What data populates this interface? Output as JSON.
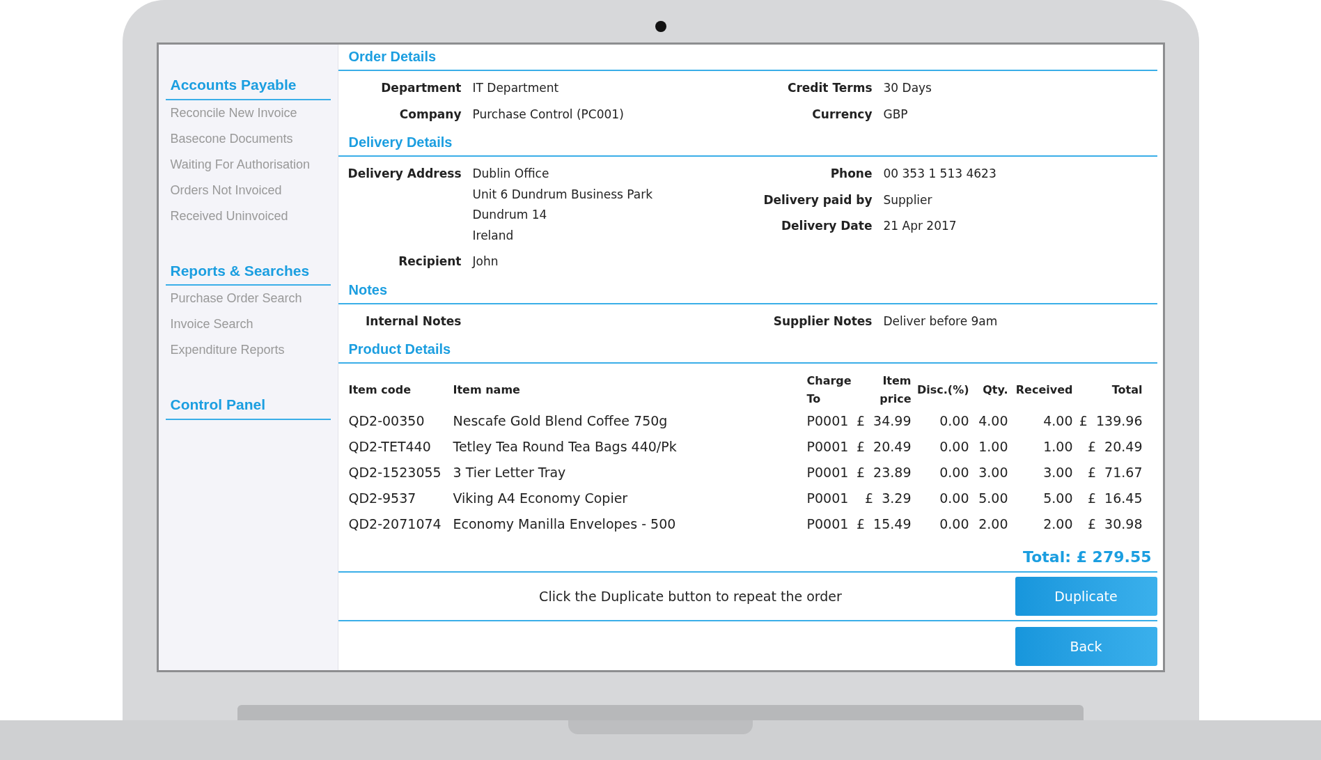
{
  "sidebar": {
    "sections": [
      {
        "title": "Accounts Payable",
        "items": [
          "Reconcile New Invoice",
          "Basecone Documents",
          "Waiting For Authorisation",
          "Orders Not Invoiced",
          "Received Uninvoiced"
        ]
      },
      {
        "title": "Reports & Searches",
        "items": [
          "Purchase Order Search",
          "Invoice Search",
          "Expenditure Reports"
        ]
      },
      {
        "title": "Control Panel"
      }
    ]
  },
  "sections": [
    {
      "title": "Order Details",
      "left": [
        {
          "label": "Department",
          "values": [
            "IT Department"
          ]
        },
        {
          "label": "Company",
          "values": [
            "Purchase Control (PC001)"
          ]
        }
      ],
      "right": [
        {
          "label": "Credit Terms",
          "values": [
            "30 Days"
          ]
        },
        {
          "label": "Currency",
          "values": [
            "GBP"
          ]
        }
      ]
    },
    {
      "title": "Delivery Details",
      "left": [
        {
          "label": "Delivery Address",
          "values": [
            "Dublin Office",
            "Unit 6 Dundrum Business Park",
            "Dundrum 14",
            "Ireland"
          ]
        },
        {
          "label": "Recipient",
          "values": [
            "John"
          ]
        }
      ],
      "right": [
        {
          "label": "Phone",
          "values": [
            "00 353 1 513 4623"
          ]
        },
        {
          "label": "Delivery paid by",
          "values": [
            "Supplier"
          ]
        },
        {
          "label": "Delivery Date",
          "values": [
            "21 Apr 2017"
          ]
        }
      ]
    },
    {
      "title": "Notes",
      "left": [
        {
          "label": "Internal Notes"
        }
      ],
      "right": [
        {
          "label": "Supplier Notes",
          "values": [
            "Deliver before 9am"
          ]
        }
      ]
    }
  ],
  "products": {
    "title": "Product Details",
    "columns": [
      "Item code",
      "Item name",
      "Charge To",
      "Item price",
      "Disc.(%)",
      "Qty.",
      "Received",
      "Total"
    ],
    "rows": [
      [
        "QD2-00350",
        "Nescafe Gold Blend Coffee 750g",
        "P0001",
        "£  34.99",
        "0.00",
        "4.00",
        "4.00",
        "£  139.96"
      ],
      [
        "QD2-TET440",
        "Tetley Tea Round Tea Bags 440/Pk",
        "P0001",
        "£  20.49",
        "0.00",
        "1.00",
        "1.00",
        "£  20.49"
      ],
      [
        "QD2-1523055",
        "3 Tier Letter Tray",
        "P0001",
        "£  23.89",
        "0.00",
        "3.00",
        "3.00",
        "£  71.67"
      ],
      [
        "QD2-9537",
        "Viking A4 Economy Copier",
        "P0001",
        "£  3.29",
        "0.00",
        "5.00",
        "5.00",
        "£  16.45"
      ],
      [
        "QD2-2071074",
        "Economy Manilla Envelopes - 500",
        "P0001",
        "£  15.49",
        "0.00",
        "2.00",
        "2.00",
        "£  30.98"
      ]
    ],
    "total": "Total: £ 279.55"
  },
  "hint": "Click the Duplicate button to repeat the order",
  "buttons": [
    "Duplicate",
    "Back"
  ]
}
